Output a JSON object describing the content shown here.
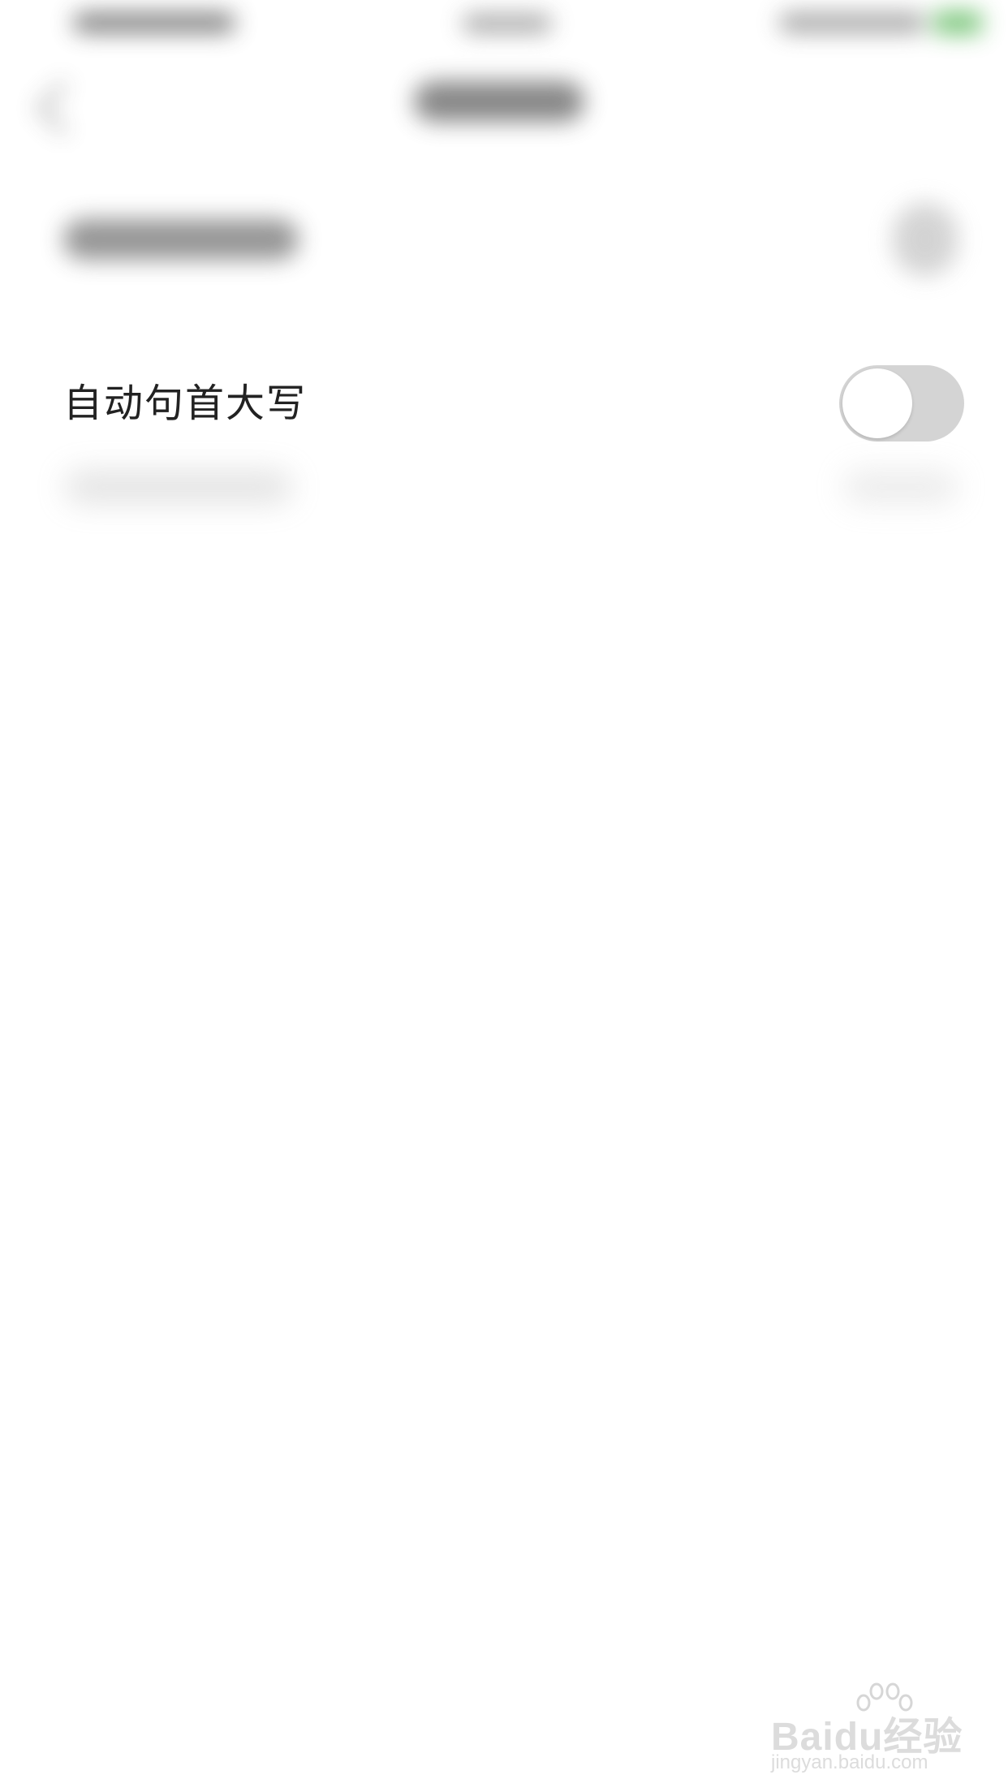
{
  "setting": {
    "label": "自动句首大写",
    "toggle_on": false
  },
  "colors": {
    "toggle_track_off": "#d4d4d4",
    "toggle_knob": "#ffffff",
    "label_text": "#222222",
    "background": "#ffffff"
  },
  "watermark": {
    "brand": "Baidu经验",
    "url": "jingyan.baidu.com"
  },
  "icons": {
    "back": "chevron-left-icon",
    "paw": "baidu-paw-icon"
  }
}
